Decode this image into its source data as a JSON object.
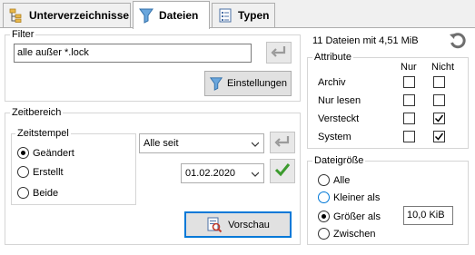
{
  "tabs": [
    {
      "label": "Unterverzeichnisse",
      "icon": "folder-tree-icon"
    },
    {
      "label": "Dateien",
      "icon": "filter-funnel-icon"
    },
    {
      "label": "Typen",
      "icon": "file-list-icon"
    }
  ],
  "filter": {
    "title": "Filter",
    "value": "alle außer *.lock",
    "settings_button": "Einstellungen"
  },
  "zeitbereich": {
    "title": "Zeitbereich",
    "zeitstempel": {
      "title": "Zeitstempel",
      "options": [
        "Geändert",
        "Erstellt",
        "Beide"
      ],
      "selected": "Geändert"
    },
    "range_select": "Alle seit",
    "date_value": "01.02.2020",
    "preview_button": "Vorschau"
  },
  "summary": "11 Dateien mit 4,51 MiB",
  "attribute": {
    "title": "Attribute",
    "col_only": "Nur",
    "col_not": "Nicht",
    "rows": [
      {
        "label": "Archiv",
        "only": false,
        "not": false
      },
      {
        "label": "Nur lesen",
        "only": false,
        "not": false
      },
      {
        "label": "Versteckt",
        "only": false,
        "not": true
      },
      {
        "label": "System",
        "only": false,
        "not": true
      }
    ]
  },
  "dateigroesse": {
    "title": "Dateigröße",
    "options": [
      "Alle",
      "Kleiner als",
      "Größer als",
      "Zwischen"
    ],
    "selected": "Größer als",
    "size_value": "10,0 KiB"
  },
  "colors": {
    "accent": "#0078d7",
    "check_green": "#3c9b2e",
    "funnel_blue": "#3a7fc4"
  }
}
